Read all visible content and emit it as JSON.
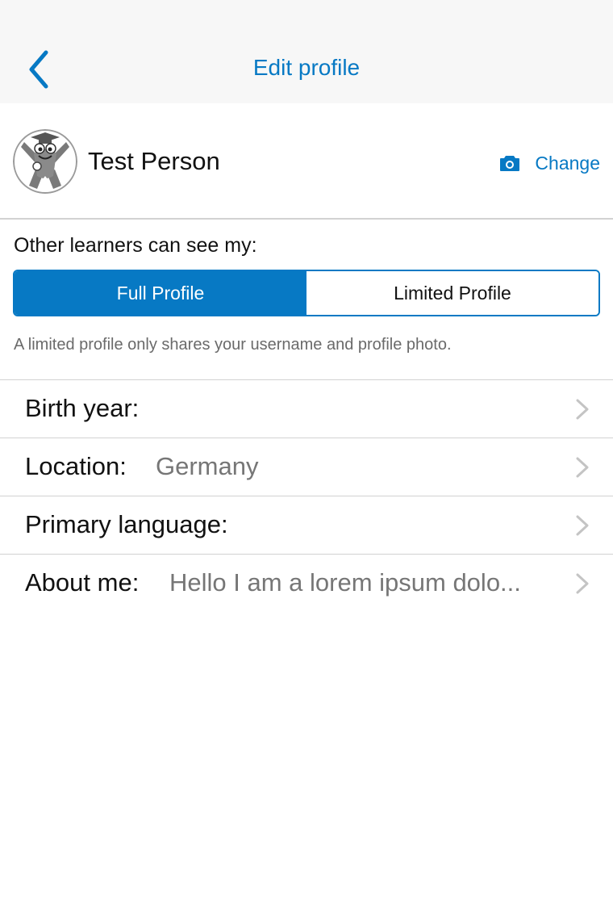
{
  "nav": {
    "title": "Edit profile"
  },
  "profile": {
    "name": "Test Person",
    "change_label": "Change"
  },
  "visibility": {
    "label": "Other learners can see my:",
    "options": [
      "Full Profile",
      "Limited Profile"
    ],
    "selected": "Full Profile",
    "note": "A limited profile only shares your username and profile photo."
  },
  "fields": [
    {
      "label": "Birth year:",
      "value": ""
    },
    {
      "label": "Location:",
      "value": "Germany"
    },
    {
      "label": "Primary language:",
      "value": ""
    },
    {
      "label": "About me:",
      "value": "Hello I am a lorem ipsum dolo..."
    }
  ],
  "colors": {
    "accent": "#0779c4",
    "secondary_text": "#767676",
    "divider": "#d2d2d2"
  },
  "icons": {
    "back": "chevron-left-icon",
    "camera": "camera-icon",
    "disclosure": "chevron-right-icon"
  }
}
